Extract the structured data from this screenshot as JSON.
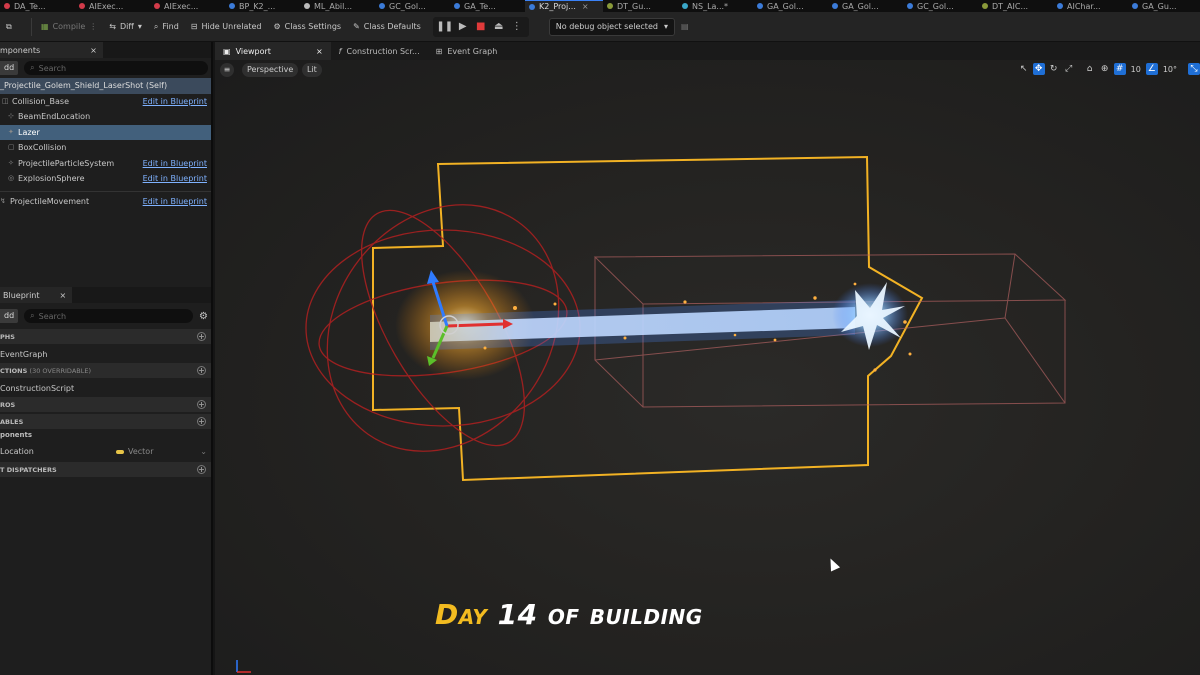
{
  "document_tabs": [
    {
      "label": "DA_Te...",
      "color": "#d23b4a",
      "active": false
    },
    {
      "label": "AIExec...",
      "color": "#d23b4a",
      "active": false
    },
    {
      "label": "AIExec...",
      "color": "#d23b4a",
      "active": false
    },
    {
      "label": "BP_K2_...",
      "color": "#3b7bd8",
      "active": false
    },
    {
      "label": "ML_Abil...",
      "color": "#bbbbbb",
      "active": false
    },
    {
      "label": "GC_Gol...",
      "color": "#3b7bd8",
      "active": false
    },
    {
      "label": "GA_Te...",
      "color": "#3b7bd8",
      "active": false
    },
    {
      "label": "K2_Proj...",
      "color": "#3b7bd8",
      "active": true
    },
    {
      "label": "DT_Gu...",
      "color": "#8a9a3a",
      "active": false
    },
    {
      "label": "NS_La...*",
      "color": "#3aa7c8",
      "active": false
    },
    {
      "label": "GA_Gol...",
      "color": "#3b7bd8",
      "active": false
    },
    {
      "label": "GA_Gol...",
      "color": "#3b7bd8",
      "active": false
    },
    {
      "label": "GC_Gol...",
      "color": "#3b7bd8",
      "active": false
    },
    {
      "label": "DT_AIC...",
      "color": "#8a9a3a",
      "active": false
    },
    {
      "label": "AIChar...",
      "color": "#3b7bd8",
      "active": false
    },
    {
      "label": "GA_Gu...",
      "color": "#3b7bd8",
      "active": false
    }
  ],
  "toolbar": {
    "compile": "Compile",
    "diff": "Diff",
    "find": "Find",
    "hide_unrelated": "Hide Unrelated",
    "class_settings": "Class Settings",
    "class_defaults": "Class Defaults",
    "debug_object": "No debug object selected"
  },
  "components_panel": {
    "tab_label": "mponents",
    "add_label": "dd",
    "search_placeholder": "Search",
    "self_label": "_Projectile_Golem_Shield_LaserShot (Self)",
    "items": [
      {
        "name": "Collision_Base",
        "edit": "Edit in Blueprint",
        "selected": false
      },
      {
        "name": "BeamEndLocation",
        "edit": "",
        "selected": false
      },
      {
        "name": "Lazer",
        "edit": "",
        "selected": true
      },
      {
        "name": "BoxCollision",
        "edit": "",
        "selected": false
      },
      {
        "name": "ProjectileParticleSystem",
        "edit": "Edit in Blueprint",
        "selected": false
      },
      {
        "name": "ExplosionSphere",
        "edit": "Edit in Blueprint",
        "selected": false
      }
    ],
    "movement": {
      "name": "ProjectileMovement",
      "edit": "Edit in Blueprint"
    }
  },
  "blueprint_panel": {
    "tab_label": "Blueprint",
    "add_label": "dd",
    "search_placeholder": "Search",
    "graphs_header": "PHS",
    "graph_item": "EventGraph",
    "functions_header": "CTIONS",
    "functions_sub": "(30 OVERRIDABLE)",
    "function_item": "ConstructionScript",
    "macros_header": "ROS",
    "variables_header": "ABLES",
    "components_sub": "ponents",
    "variable_name": "Location",
    "variable_type": "Vector",
    "dispatchers_header": "T DISPATCHERS"
  },
  "viewport_tabs": [
    "Viewport",
    "Construction Scr...",
    "Event Graph"
  ],
  "viewport": {
    "perspective": "Perspective",
    "lit": "Lit",
    "grid_snap": "10",
    "rot_snap": "10°"
  },
  "caption": {
    "day": "Day",
    "rest": "14 of building"
  }
}
